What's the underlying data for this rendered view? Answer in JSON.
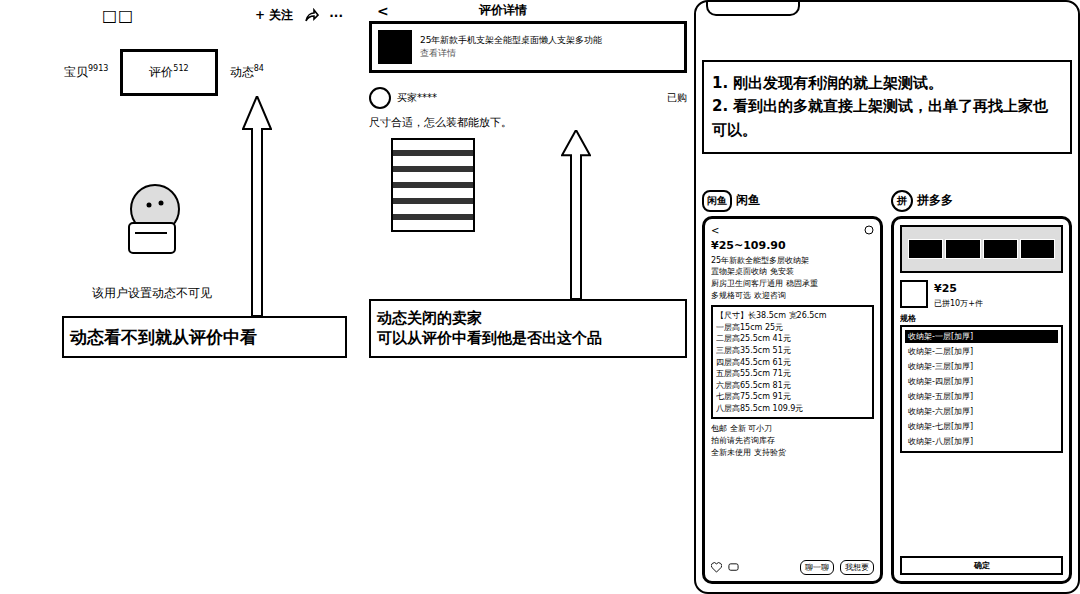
{
  "profile_screen": {
    "shop_name": "□□",
    "follow_button": "+ 关注",
    "more_button": "···",
    "tabs": [
      {
        "label": "宝贝",
        "count": "9913",
        "highlighted": false
      },
      {
        "label": "评价",
        "count": "512",
        "highlighted": true
      },
      {
        "label": "动态",
        "count": "84",
        "highlighted": false
      }
    ],
    "empty_text": "该用户设置动态不可见",
    "callout": [
      "动态看不到就从评价中看"
    ]
  },
  "review_screen": {
    "back_button": "<",
    "title": "评价详情",
    "product": {
      "title": "25年新款手机支架全能型桌面懒人支架多功能",
      "subtitle": "查看详情"
    },
    "reviewer": {
      "name": "买家****",
      "badge": "已购"
    },
    "review_text": "尺寸合适，怎么装都能放下。",
    "callout": [
      "动态关闭的卖家",
      "可以从评价中看到他是否出这个品"
    ]
  },
  "tips_screen": {
    "notes": [
      "1. 刚出发现有利润的就上架测试。",
      "2. 看到出的多就直接上架测试，出单了再找上家也可以。"
    ],
    "platforms": [
      {
        "name": "闲鱼",
        "logo": "闲鱼"
      },
      {
        "name": "拼多多",
        "logo": "拼"
      }
    ],
    "xianyu_listing": {
      "back_button": "<",
      "price": "¥25~109.90",
      "description": [
        "25年新款全能型多层收纳架",
        "置物架桌面收纳 免安装",
        "厨房卫生间客厅通用 稳固承重",
        "多规格可选 欢迎咨询"
      ],
      "sizes_title": "【尺寸】长38.5cm 宽26.5cm",
      "sizes": [
        "一层高15cm 25元",
        "二层高25.5cm 41元",
        "三层高35.5cm 51元",
        "四层高45.5cm 61元",
        "五层高55.5cm 71元",
        "六层高65.5cm 81元",
        "七层高75.5cm 91元",
        "八层高85.5cm 109.9元"
      ],
      "footer_lines": [
        "包邮 全新 可小刀",
        "拍前请先咨询库存",
        "全新未使用 支持验货"
      ],
      "actions": [
        "聊一聊",
        "我想要"
      ]
    },
    "pdd_listing": {
      "price": "¥25",
      "sales": "已拼10万+件",
      "spec_title": "规格",
      "options": [
        {
          "label": "收纳架-一层[加厚]",
          "selected": true
        },
        {
          "label": "收纳架-二层[加厚]",
          "selected": false
        },
        {
          "label": "收纳架-三层[加厚]",
          "selected": false
        },
        {
          "label": "收纳架-四层[加厚]",
          "selected": false
        },
        {
          "label": "收纳架-五层[加厚]",
          "selected": false
        },
        {
          "label": "收纳架-六层[加厚]",
          "selected": false
        },
        {
          "label": "收纳架-七层[加厚]",
          "selected": false
        },
        {
          "label": "收纳架-八层[加厚]",
          "selected": false
        }
      ],
      "confirm_button": "确定"
    }
  }
}
